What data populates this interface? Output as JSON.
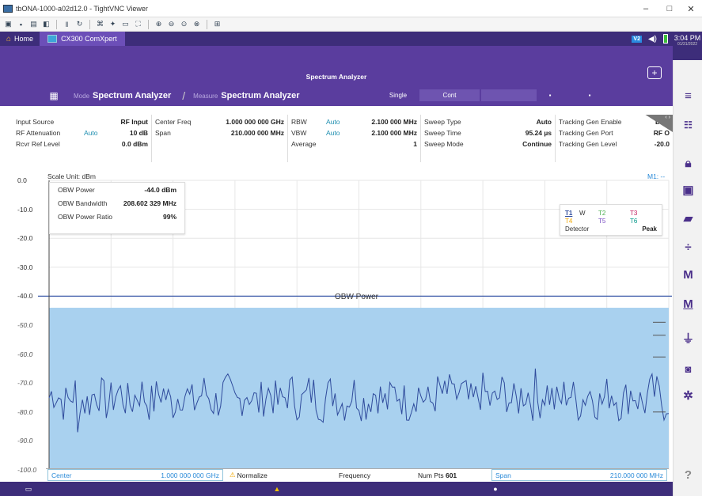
{
  "window": {
    "title": "tbONA-1000-a02d12.0 - TightVNC Viewer",
    "controls": {
      "minimize": "–",
      "maximize": "□",
      "close": "✕"
    }
  },
  "vnc_toolbar": {
    "buttons": [
      "new-connection-icon",
      "save-icon",
      "options-icon",
      "info-icon",
      "pause-icon",
      "refresh-icon",
      "ctrl-alt-del-icon",
      "ctrl-icon",
      "alt-icon",
      "fullscreen-icon",
      "zoom-in-icon",
      "zoom-out-icon",
      "zoom-100-icon",
      "zoom-fit-icon",
      "transfer-icon"
    ]
  },
  "topbar": {
    "home_label": "Home",
    "app_tab_label": "CX300 ComXpert",
    "badge": "V2",
    "time": "3:04 PM",
    "date": "01/31/2022"
  },
  "header": {
    "title": "Spectrum Analyzer",
    "mode_label": "Mode",
    "mode_value": "Spectrum Analyzer",
    "measure_label": "Measure",
    "measure_value": "Spectrum Analyzer",
    "single_label": "Single",
    "cont_label": "Cont"
  },
  "params": {
    "col1": [
      {
        "label": "Input Source",
        "value": "RF Input"
      },
      {
        "label": "RF Attenuation",
        "auto": "Auto",
        "value": "10 dB"
      },
      {
        "label": "Rcvr Ref Level",
        "value": "0.0 dBm"
      }
    ],
    "col2": [
      {
        "label": "Center Freq",
        "value": "1.000 000 000 GHz"
      },
      {
        "label": "Span",
        "value": "210.000 000 MHz"
      }
    ],
    "col3": [
      {
        "label": "RBW",
        "auto": "Auto",
        "value": "2.100 000 MHz"
      },
      {
        "label": "VBW",
        "auto": "Auto",
        "value": "2.100 000 MHz"
      },
      {
        "label": "Average",
        "value": "1"
      }
    ],
    "col4": [
      {
        "label": "Sweep Type",
        "value": "Auto"
      },
      {
        "label": "Sweep Time",
        "value": "95.24 µs"
      },
      {
        "label": "Sweep Mode",
        "value": "Continue"
      }
    ],
    "col5": [
      {
        "label": "Tracking Gen Enable",
        "value": "Disa"
      },
      {
        "label": "Tracking Gen Port",
        "value": "RF O"
      },
      {
        "label": "Tracking Gen Level",
        "value": "-20.0"
      }
    ]
  },
  "plot": {
    "scale_unit": "Scale Unit: dBm",
    "marker_label": "M1: --",
    "y_labels": [
      "0.0",
      "-10.0",
      "-20.0",
      "-30.0",
      "-40.0",
      "-50.0",
      "-60.0",
      "-70.0",
      "-80.0",
      "-90.0",
      "-100.0"
    ],
    "obw_label": "OBW Power",
    "colors": {
      "fill": "#a9d1ef",
      "trace": "#2f4b9c",
      "marker_line": "#3c5aa8",
      "grid": "#e6e6e6"
    }
  },
  "obw": {
    "rows": [
      {
        "label": "OBW Power",
        "value": "-44.0 dBm"
      },
      {
        "label": "OBW Bandwidth",
        "value": "208.602 329 MHz"
      },
      {
        "label": "OBW Power Ratio",
        "value": "99%"
      }
    ]
  },
  "traces": {
    "t1": "T1",
    "w": "W",
    "t2": "T2",
    "t3": "T3",
    "t4": "T4",
    "t5": "T5",
    "t6": "T6",
    "detector_label": "Detector",
    "detector_value": "Peak"
  },
  "bottom": {
    "center_label": "Center",
    "center_value": "1.000 000 000 GHz",
    "normalize_label": "Normalize",
    "frequency_label": "Frequency",
    "numpts_label": "Num Pts",
    "numpts_value": "601",
    "span_label": "Span",
    "span_value": "210.000 000 MHz"
  }
}
